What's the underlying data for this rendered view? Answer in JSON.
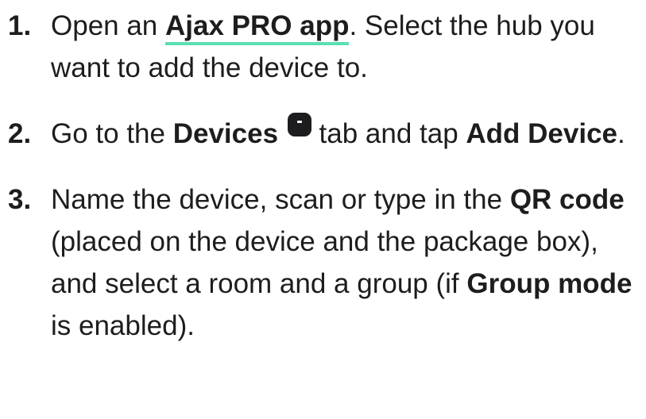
{
  "steps": [
    {
      "number": "1.",
      "prefix": "Open an ",
      "link": "Ajax PRO app",
      "suffix": ". Select the hub you want to add the device to."
    },
    {
      "number": "2.",
      "t1": "Go to the ",
      "b1": "Devices",
      "icon": "devices-tab-icon",
      "t2": " tab and tap ",
      "b2": "Add Device",
      "t3": "."
    },
    {
      "number": "3.",
      "t1": "Name the device, scan or type in the ",
      "b1": "QR code",
      "t2": " (placed on the device and the package box), and select a room and a group (if ",
      "b2": "Group mode",
      "t3": " is enabled)."
    }
  ],
  "colors": {
    "text": "#1d1d1f",
    "link_underline": "#5ae0b0"
  }
}
